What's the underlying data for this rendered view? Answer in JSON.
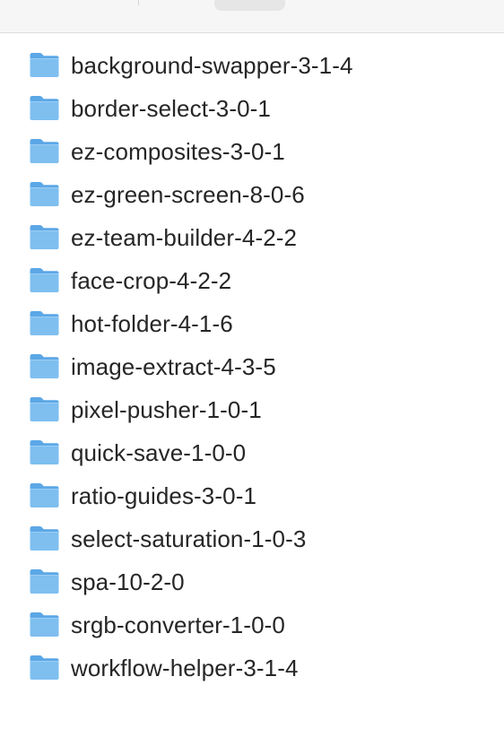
{
  "files": [
    {
      "name": "background-swapper-3-1-4",
      "icon": "folder-icon"
    },
    {
      "name": "border-select-3-0-1",
      "icon": "folder-icon"
    },
    {
      "name": "ez-composites-3-0-1",
      "icon": "folder-icon"
    },
    {
      "name": "ez-green-screen-8-0-6",
      "icon": "folder-icon"
    },
    {
      "name": "ez-team-builder-4-2-2",
      "icon": "folder-icon"
    },
    {
      "name": "face-crop-4-2-2",
      "icon": "folder-icon"
    },
    {
      "name": "hot-folder-4-1-6",
      "icon": "folder-icon"
    },
    {
      "name": "image-extract-4-3-5",
      "icon": "folder-icon"
    },
    {
      "name": "pixel-pusher-1-0-1",
      "icon": "folder-icon"
    },
    {
      "name": "quick-save-1-0-0",
      "icon": "folder-icon"
    },
    {
      "name": "ratio-guides-3-0-1",
      "icon": "folder-icon"
    },
    {
      "name": "select-saturation-1-0-3",
      "icon": "folder-icon"
    },
    {
      "name": "spa-10-2-0",
      "icon": "folder-icon"
    },
    {
      "name": "srgb-converter-1-0-0",
      "icon": "folder-icon"
    },
    {
      "name": "workflow-helper-3-1-4",
      "icon": "folder-icon"
    }
  ],
  "colors": {
    "folder_front": "#7ebff0",
    "folder_back": "#5ba7e6",
    "text": "#262626",
    "toolbar_bg": "#f6f6f6",
    "divider": "#dcdcdc"
  }
}
